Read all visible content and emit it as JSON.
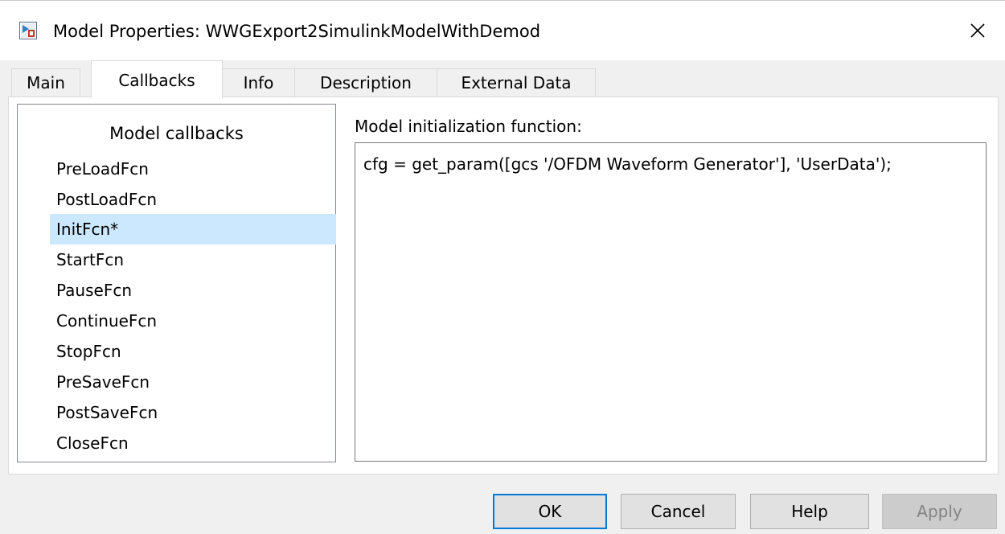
{
  "window": {
    "title": "Model Properties: WWGExport2SimulinkModelWithDemod",
    "app_icon": "simulink-model-icon",
    "close_icon": "close-icon"
  },
  "tabs": [
    {
      "label": "Main",
      "active": false
    },
    {
      "label": "Callbacks",
      "active": true
    },
    {
      "label": "Info",
      "active": false
    },
    {
      "label": "Description",
      "active": false
    },
    {
      "label": "External Data",
      "active": false
    }
  ],
  "callbacks": {
    "header": "Model callbacks",
    "selected": "InitFcn*",
    "items": [
      "PreLoadFcn",
      "PostLoadFcn",
      "InitFcn*",
      "StartFcn",
      "PauseFcn",
      "ContinueFcn",
      "StopFcn",
      "PreSaveFcn",
      "PostSaveFcn",
      "CloseFcn"
    ]
  },
  "editor": {
    "label": "Model initialization function:",
    "code": "cfg = get_param([gcs '/OFDM Waveform Generator'], 'UserData');"
  },
  "buttons": {
    "ok": "OK",
    "cancel": "Cancel",
    "help": "Help",
    "apply": "Apply"
  },
  "colors": {
    "selection": "#cce8ff",
    "default_button_border": "#0078d7"
  }
}
